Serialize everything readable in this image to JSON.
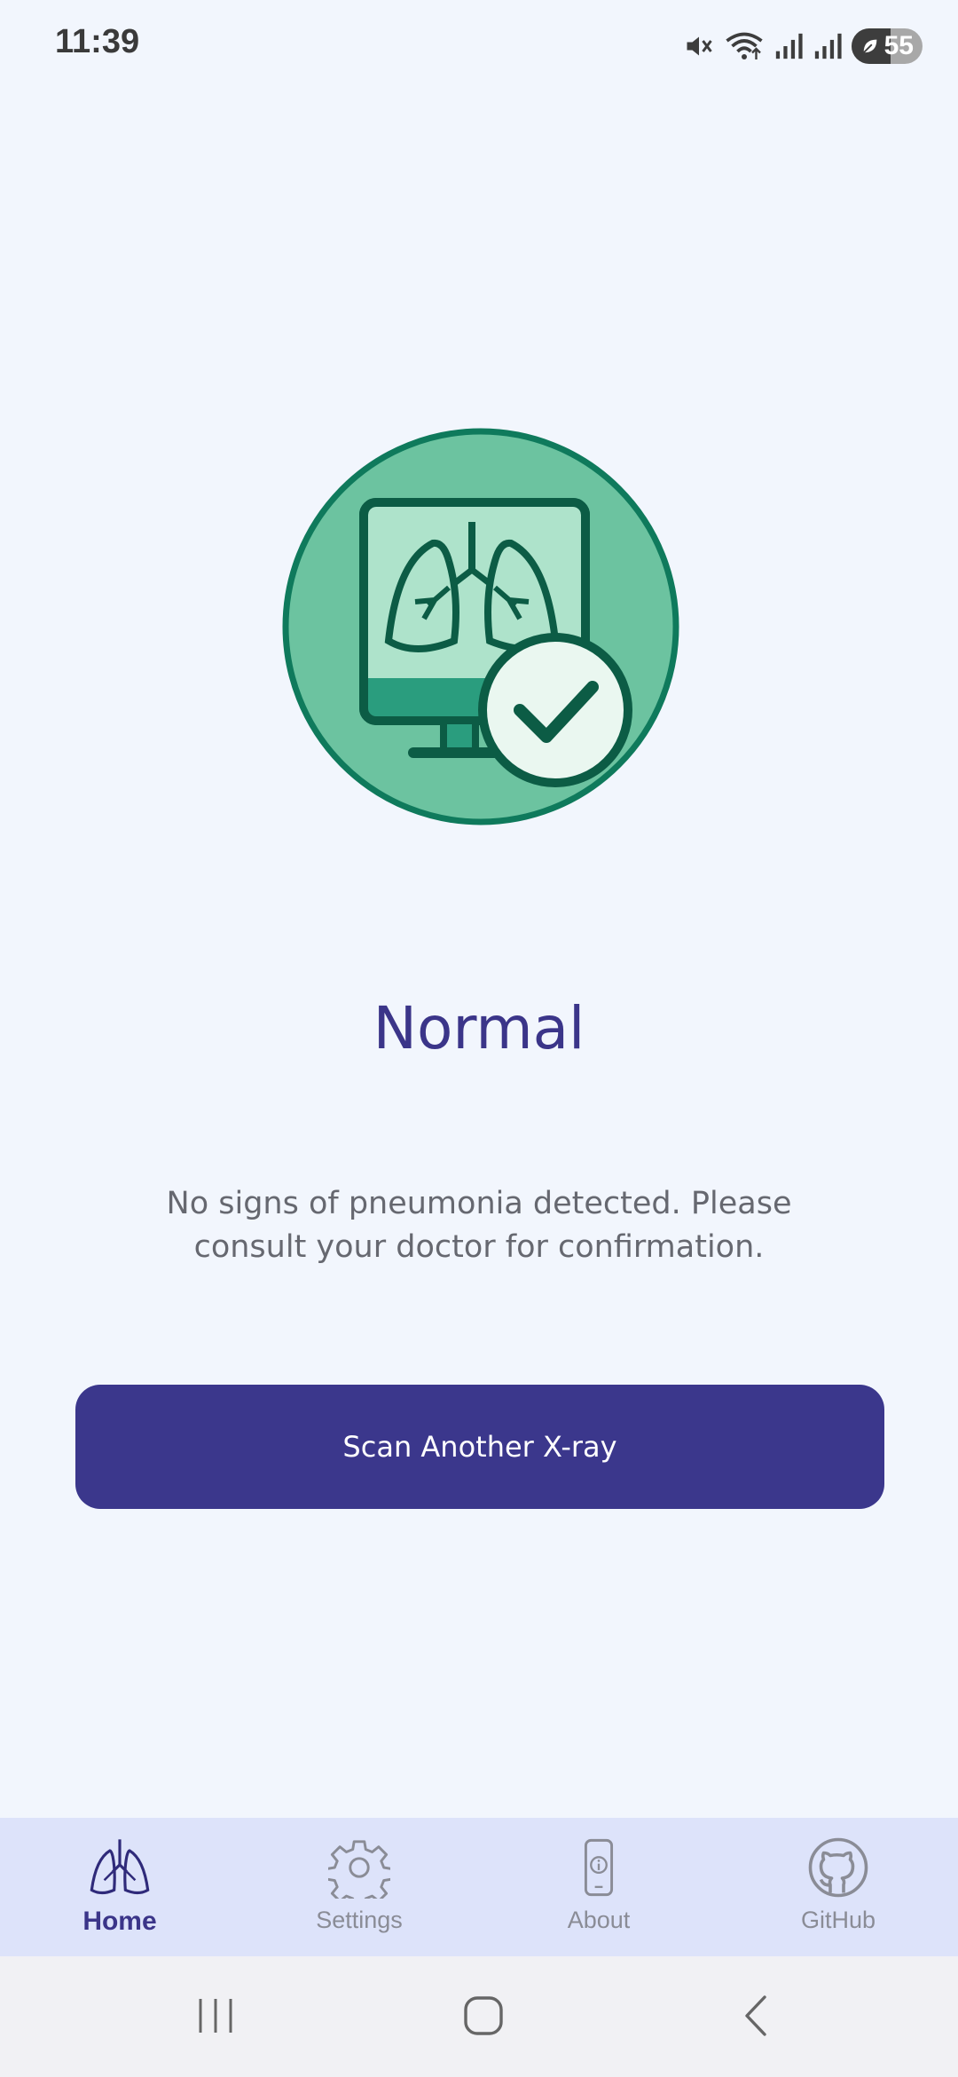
{
  "status_bar": {
    "time": "11:39",
    "battery_level": "55",
    "icons": [
      "mute-icon",
      "wifi-icon",
      "signal-icon",
      "signal-icon",
      "battery-saver-icon"
    ]
  },
  "result": {
    "title": "Normal",
    "message": "No signs of pneumonia detected. Please consult your doctor for confirmation.",
    "illustration": "lungs-monitor-check-icon"
  },
  "actions": {
    "scan_again_label": "Scan Another X-ray"
  },
  "bottom_nav": {
    "items": [
      {
        "label": "Home",
        "icon": "lungs-icon",
        "active": true
      },
      {
        "label": "Settings",
        "icon": "gear-icon",
        "active": false
      },
      {
        "label": "About",
        "icon": "phone-info-icon",
        "active": false
      },
      {
        "label": "GitHub",
        "icon": "github-icon",
        "active": false
      }
    ]
  },
  "system_nav": {
    "icons": [
      "recents-icon",
      "home-icon",
      "back-icon"
    ]
  },
  "colors": {
    "background": "#f2f6fd",
    "primary": "#3b378c",
    "success_dark": "#0f7a5c",
    "success_light": "#6cc3a0",
    "nav_background": "#dde3fa"
  }
}
